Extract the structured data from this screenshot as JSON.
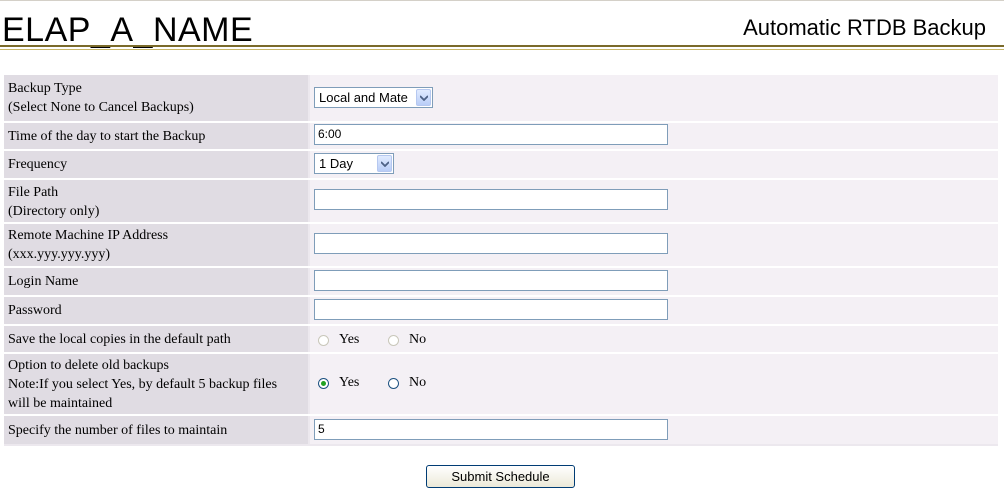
{
  "header": {
    "app_name": "ELAP_A_NAME",
    "page_title": "Automatic RTDB Backup"
  },
  "form": {
    "backup_type": {
      "label_line1": "Backup Type",
      "label_line2": "(Select None to Cancel Backups)",
      "value": "Local and Mate"
    },
    "start_time": {
      "label": "Time of the day to start the Backup",
      "value": "6:00"
    },
    "frequency": {
      "label": "Frequency",
      "value": "1 Day"
    },
    "file_path": {
      "label_line1": "File Path",
      "label_line2": "(Directory only)",
      "value": ""
    },
    "remote_ip": {
      "label_line1": "Remote Machine IP Address",
      "label_line2": "(xxx.yyy.yyy.yyy)",
      "value": ""
    },
    "login_name": {
      "label": "Login Name",
      "value": ""
    },
    "password": {
      "label": "Password",
      "value": ""
    },
    "save_local": {
      "label": "Save the local copies in the default path",
      "yes_label": "Yes",
      "no_label": "No",
      "selected": "none",
      "disabled": true
    },
    "delete_old": {
      "label_line1": "Option to delete old backups",
      "label_line2": "Note:If you select Yes, by default 5 backup files",
      "label_line3": "will be maintained",
      "yes_label": "Yes",
      "no_label": "No",
      "selected": "Yes"
    },
    "num_files": {
      "label": "Specify the number of files to maintain",
      "value": "5"
    }
  },
  "submit_label": "Submit Schedule",
  "colors": {
    "label_bg": "#e0dce3",
    "value_bg": "#f4f0f5",
    "header_rule": "#7a6a2a"
  }
}
